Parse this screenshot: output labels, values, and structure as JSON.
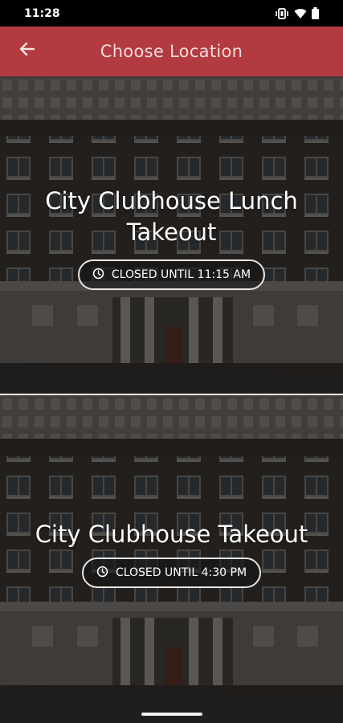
{
  "status_bar": {
    "time": "11:28",
    "icons": [
      "vibrate-icon",
      "wifi-icon",
      "battery-icon"
    ]
  },
  "app_bar": {
    "title": "Choose Location",
    "back_icon": "arrow-left-icon",
    "color": "#b33a40"
  },
  "locations": [
    {
      "title": "City Clubhouse Lunch Takeout",
      "status_icon": "clock-icon",
      "status": "CLOSED UNTIL 11:15 AM"
    },
    {
      "title": "City Clubhouse Takeout",
      "status_icon": "clock-icon",
      "status": "CLOSED UNTIL 4:30 PM"
    }
  ]
}
